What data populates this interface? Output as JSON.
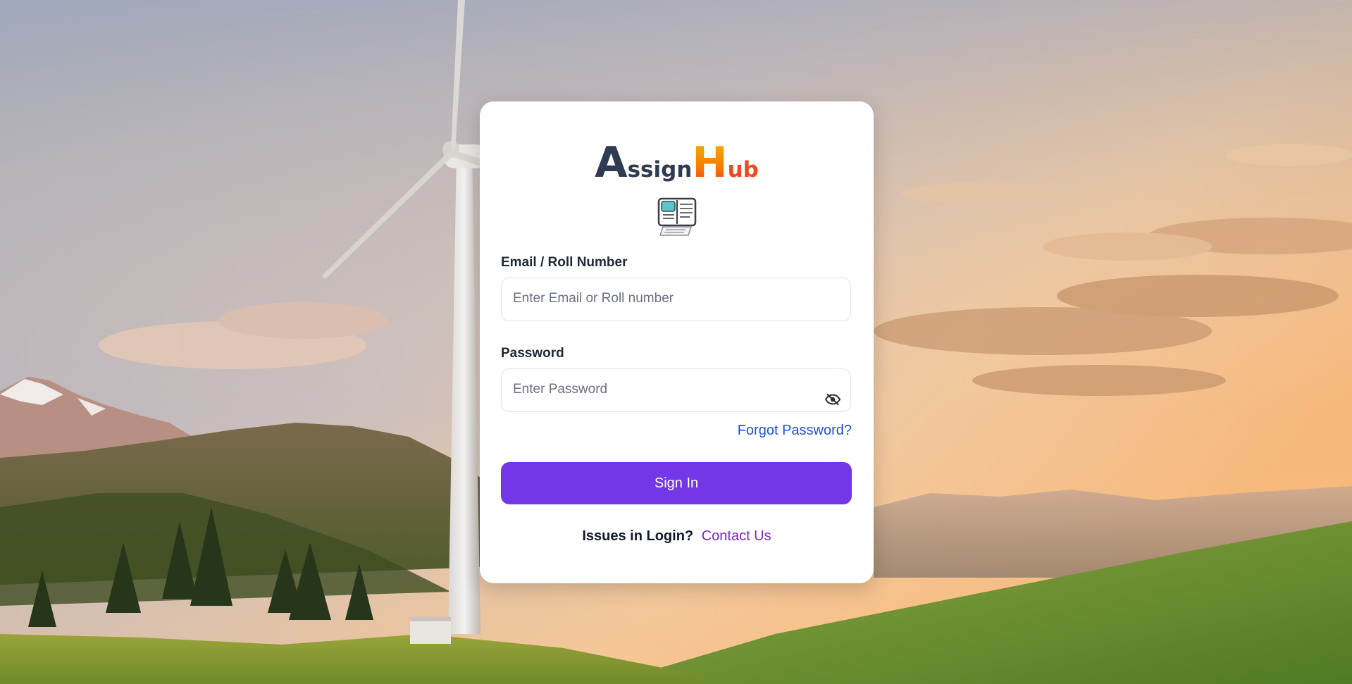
{
  "brand": {
    "letter_a": "A",
    "rest_a": "ssign",
    "letter_h": "H",
    "rest_h": "ub"
  },
  "logo_icon": "book-desk-icon",
  "form": {
    "email_label": "Email / Roll Number",
    "email_placeholder": "Enter Email or Roll number",
    "email_value": "",
    "password_label": "Password",
    "password_placeholder": "Enter Password",
    "password_value": "",
    "password_toggle_icon": "eye-off-icon",
    "forgot_label": "Forgot Password?",
    "signin_label": "Sign In"
  },
  "footer": {
    "issues_text": "Issues in Login?",
    "contact_label": "Contact Us"
  },
  "colors": {
    "primary_button": "#7337e8",
    "forgot_link": "#1d4ed8",
    "contact_link": "#7e22ce",
    "brand_dark": "#2f3b52",
    "brand_orange": "#f57c00"
  }
}
